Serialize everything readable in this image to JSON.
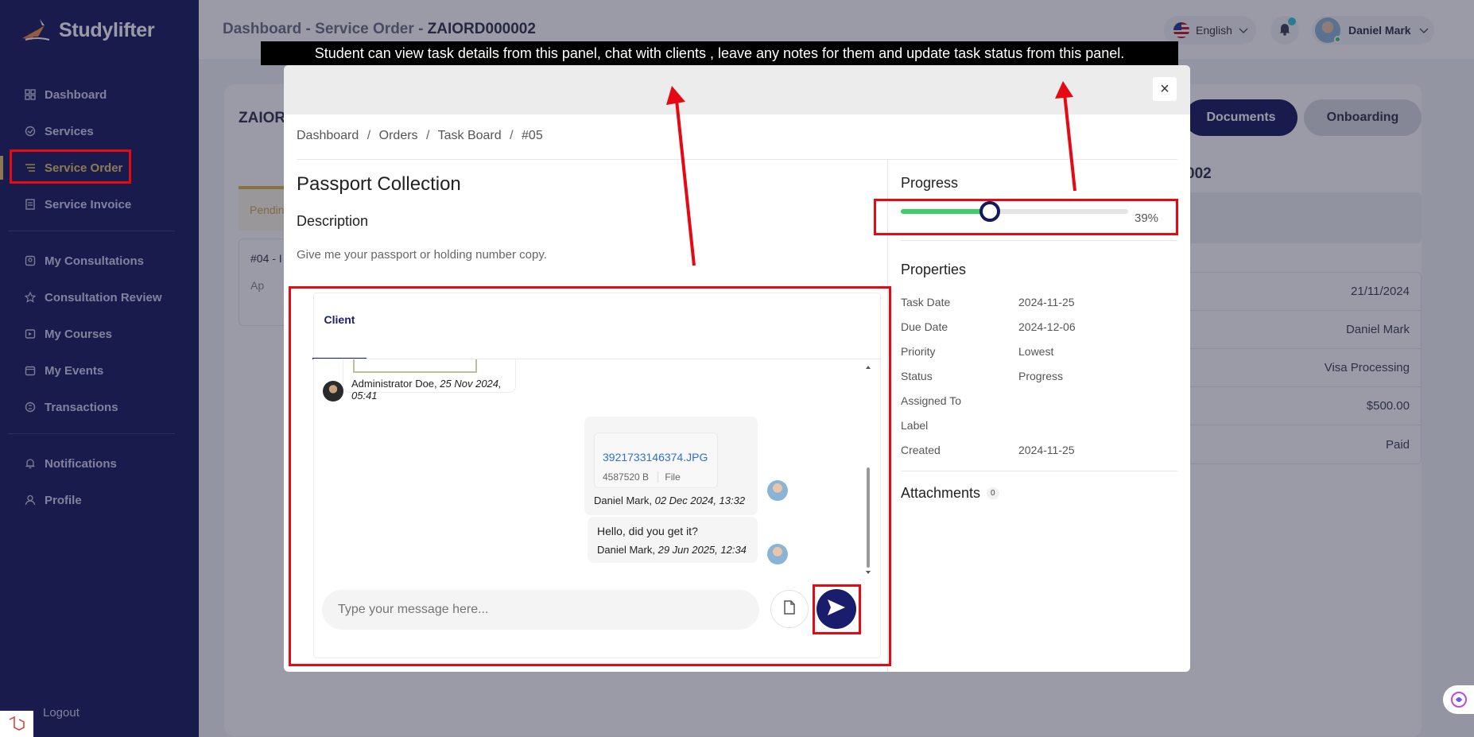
{
  "brand": {
    "name": "Studylifter"
  },
  "sidebar": {
    "items": [
      {
        "label": "Dashboard",
        "icon": "dashboard-icon",
        "active": false
      },
      {
        "label": "Services",
        "icon": "services-icon",
        "active": false
      },
      {
        "label": "Service Order",
        "icon": "service-order-icon",
        "active": true
      },
      {
        "label": "Service Invoice",
        "icon": "invoice-icon",
        "active": false
      },
      {
        "label": "My Consultations",
        "icon": "consultations-icon",
        "active": false
      },
      {
        "label": "Consultation Review",
        "icon": "star-icon",
        "active": false
      },
      {
        "label": "My Courses",
        "icon": "courses-icon",
        "active": false
      },
      {
        "label": "My Events",
        "icon": "events-icon",
        "active": false
      },
      {
        "label": "Transactions",
        "icon": "transactions-icon",
        "active": false
      },
      {
        "label": "Notifications",
        "icon": "bell-icon",
        "active": false
      },
      {
        "label": "Profile",
        "icon": "user-icon",
        "active": false
      }
    ],
    "logout_label": "Logout"
  },
  "topbar": {
    "breadcrumb_1": "Dashboard",
    "breadcrumb_2": "Service Order",
    "breadcrumb_3": "ZAIORD000002",
    "separator": "-",
    "language": "English",
    "user_name": "Daniel Mark"
  },
  "background": {
    "title": "ZAIOR",
    "documents_btn": "Documents",
    "onboarding_btn": "Onboarding",
    "right_title": "002",
    "left_tab": "Pendin",
    "left_card_title": "#04 - I",
    "left_card_meta": "Ap",
    "rows": [
      "21/11/2024",
      "Daniel Mark",
      "Visa Processing",
      "$500.00",
      "Paid"
    ]
  },
  "annotation": {
    "caption": "Student can view task details from this panel, chat with clients , leave any notes for them and update task status from this panel."
  },
  "modal": {
    "close_label": "×",
    "breadcrumb": [
      "Dashboard",
      "Orders",
      "Task Board",
      "#05"
    ],
    "breadcrumb_sep": "/",
    "task_title": "Passport Collection",
    "description_heading": "Description",
    "description_text": "Give me your passport or holding number copy.",
    "chat_tab": "Client",
    "messages": {
      "admin_author": "Administrator Doe,",
      "admin_time": "25 Nov 2024, 05:41",
      "file_name": "3921733146374.JPG",
      "file_size": "4587520 B",
      "file_type": "File",
      "file_author": "Daniel Mark,",
      "file_time": "02 Dec 2024, 13:32",
      "text": "Hello, did you get it?",
      "text_author": "Daniel Mark,",
      "text_time": "29 Jun 2025, 12:34"
    },
    "composer_placeholder": "Type your message here...",
    "progress_heading": "Progress",
    "progress_value": 39,
    "progress_label": "39%",
    "properties_heading": "Properties",
    "properties": [
      {
        "key": "Task Date",
        "value": "2024-11-25"
      },
      {
        "key": "Due Date",
        "value": "2024-12-06"
      },
      {
        "key": "Priority",
        "value": "Lowest"
      },
      {
        "key": "Status",
        "value": "Progress"
      },
      {
        "key": "Assigned To",
        "value": ""
      },
      {
        "key": "Label",
        "value": ""
      },
      {
        "key": "Created",
        "value": "2024-11-25"
      }
    ],
    "attachments_heading": "Attachments",
    "attachments_count": "0"
  },
  "colors": {
    "sidebar_bg": "#17175e",
    "accent_gold": "#e8c46a",
    "primary_navy": "#1a1d6b",
    "progress_green": "#3ccf66",
    "annotation_red": "#e50914"
  }
}
